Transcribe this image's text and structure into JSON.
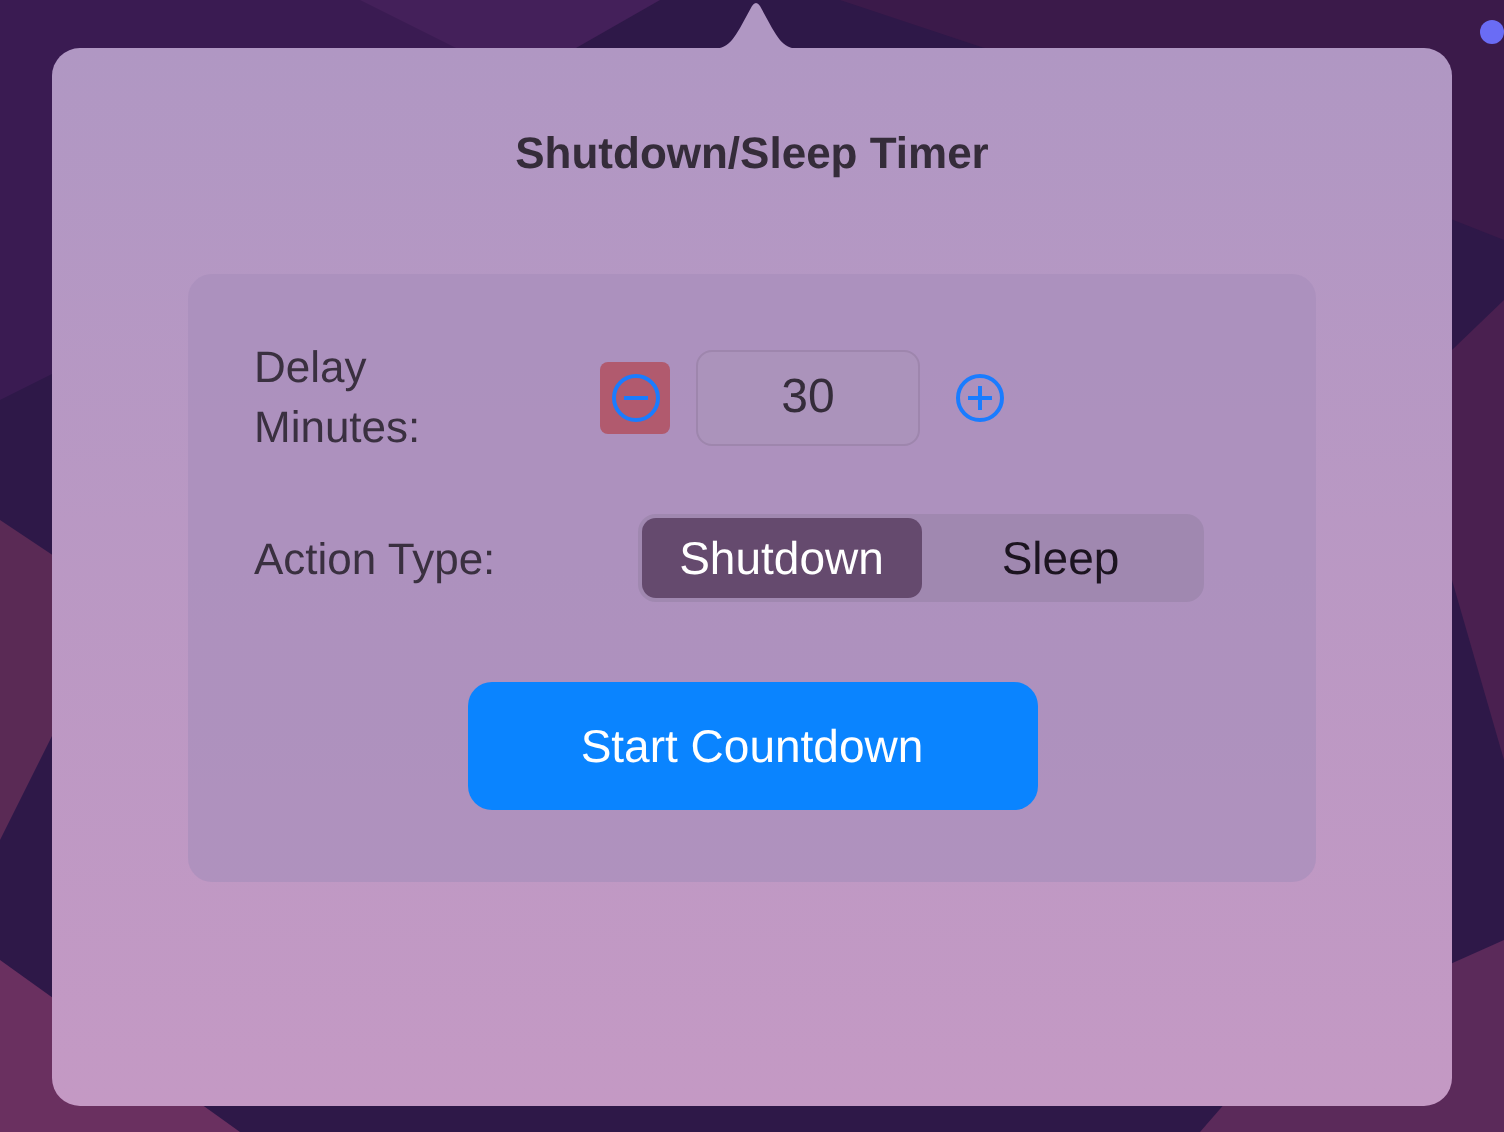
{
  "popover": {
    "title": "Shutdown/Sleep Timer"
  },
  "delay": {
    "label": "Delay Minutes:",
    "value": "30",
    "decrement_focused": true
  },
  "action": {
    "label": "Action Type:",
    "options": [
      {
        "label": "Shutdown",
        "selected": true
      },
      {
        "label": "Sleep",
        "selected": false
      }
    ]
  },
  "start_button": {
    "label": "Start Countdown"
  }
}
